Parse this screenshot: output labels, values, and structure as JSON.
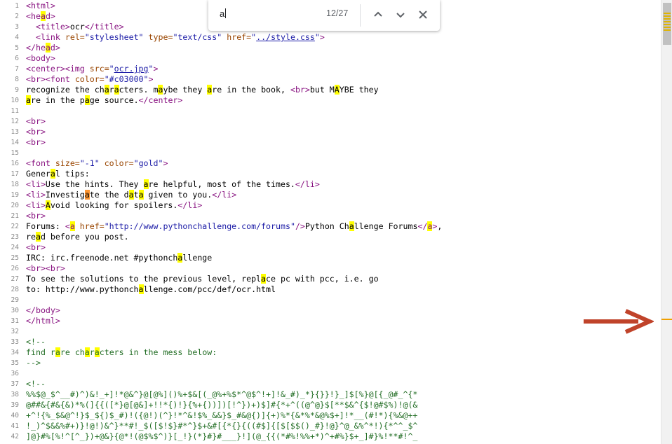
{
  "find_bar": {
    "query": "a",
    "count": "12/27"
  },
  "colors": {
    "highlight": "#ffff00",
    "current_highlight": "#ff9632",
    "tag": "#881280",
    "attribute": "#994500",
    "value": "#1a1aa6",
    "comment": "#236e25",
    "arrow": "#c0432a"
  },
  "icons": [
    "chevron-up-icon",
    "chevron-down-icon",
    "close-icon",
    "arrow-right-icon"
  ],
  "lines": [
    {
      "n": "1",
      "html": "<span class=\"tag\">&lt;html&gt;</span>"
    },
    {
      "n": "2",
      "html": "<span class=\"tag\">&lt;he<mark>a</mark>d&gt;</span>"
    },
    {
      "n": "3",
      "html": "  <span class=\"tag\">&lt;title&gt;</span>ocr<span class=\"tag\">&lt;/title&gt;</span>"
    },
    {
      "n": "4",
      "html": "  <span class=\"tag\">&lt;link </span><span class=\"attr\">rel=</span><span class=\"val\">\"stylesheet\"</span> <span class=\"attr\">type=</span><span class=\"val\">\"text/css\"</span> <span class=\"attr\">href=</span><span class=\"val\">\"</span><span class=\"lnk\">../style.css</span><span class=\"val\">\"</span><span class=\"tag\">&gt;</span>"
    },
    {
      "n": "5",
      "html": "<span class=\"tag\">&lt;/he<mark>a</mark>d&gt;</span>"
    },
    {
      "n": "6",
      "html": "<span class=\"tag\">&lt;body&gt;</span>"
    },
    {
      "n": "7",
      "html": "<span class=\"tag\">&lt;center&gt;&lt;img </span><span class=\"attr\">src=</span><span class=\"val\">\"</span><span class=\"lnk\">ocr.jpg</span><span class=\"val\">\"</span><span class=\"tag\">&gt;</span>"
    },
    {
      "n": "8",
      "html": "<span class=\"tag\">&lt;br&gt;&lt;font </span><span class=\"attr\">color=</span><span class=\"val\">\"#c03000\"</span><span class=\"tag\">&gt;</span>"
    },
    {
      "n": "9",
      "html": "recognize the ch<mark>a</mark>r<mark>a</mark>cters. m<mark>a</mark>ybe they <mark>a</mark>re in the book, <span class=\"tag\">&lt;br&gt;</span>but M<mark>A</mark>YBE they"
    },
    {
      "n": "10",
      "html": "<mark>a</mark>re in the p<mark>a</mark>ge source.<span class=\"tag\">&lt;/center&gt;</span>"
    },
    {
      "n": "11",
      "html": ""
    },
    {
      "n": "12",
      "html": "<span class=\"tag\">&lt;br&gt;</span>"
    },
    {
      "n": "13",
      "html": "<span class=\"tag\">&lt;br&gt;</span>"
    },
    {
      "n": "14",
      "html": "<span class=\"tag\">&lt;br&gt;</span>"
    },
    {
      "n": "15",
      "html": ""
    },
    {
      "n": "16",
      "html": "<span class=\"tag\">&lt;font </span><span class=\"attr\">size=</span><span class=\"val\">\"-1\"</span> <span class=\"attr\">color=</span><span class=\"val\">\"gold\"</span><span class=\"tag\">&gt;</span>"
    },
    {
      "n": "17",
      "html": "Gener<mark>a</mark>l tips:"
    },
    {
      "n": "18",
      "html": "<span class=\"tag\">&lt;li&gt;</span>Use the hints. They <mark>a</mark>re helpful, most of the times.<span class=\"tag\">&lt;/li&gt;</span>"
    },
    {
      "n": "19",
      "html": "<span class=\"tag\">&lt;li&gt;</span>Investig<mark class=\"cur\">a</mark>te the d<mark>a</mark>t<mark>a</mark> given to you.<span class=\"tag\">&lt;/li&gt;</span>"
    },
    {
      "n": "20",
      "html": "<span class=\"tag\">&lt;li&gt;</span><mark>A</mark>void looking for spoilers.<span class=\"tag\">&lt;/li&gt;</span>"
    },
    {
      "n": "21",
      "html": "<span class=\"tag\">&lt;br&gt;</span>"
    },
    {
      "n": "22",
      "html": "Forums: <span class=\"tag\">&lt;<mark>a</mark> </span><span class=\"attr\">href=</span><span class=\"val\">\"http://www.pythonchallenge.com/forums\"</span><span class=\"tag\">/&gt;</span>Python Ch<mark>a</mark>llenge Forums<span class=\"tag\">&lt;/<mark>a</mark>&gt;</span>,"
    },
    {
      "n": "23",
      "html": "re<mark>a</mark>d before you post."
    },
    {
      "n": "24",
      "html": "<span class=\"tag\">&lt;br&gt;</span>"
    },
    {
      "n": "25",
      "html": "IRC: irc.freenode.net #pythonch<mark>a</mark>llenge"
    },
    {
      "n": "26",
      "html": "<span class=\"tag\">&lt;br&gt;&lt;br&gt;</span>"
    },
    {
      "n": "27",
      "html": "To see the solutions to the previous level, repl<mark>a</mark>ce pc with pcc, i.e. go"
    },
    {
      "n": "28",
      "html": "to: http://www.pythonch<mark>a</mark>llenge.com/pcc/def/ocr.html"
    },
    {
      "n": "29",
      "html": ""
    },
    {
      "n": "30",
      "html": "<span class=\"tag\">&lt;/body&gt;</span>"
    },
    {
      "n": "31",
      "html": "<span class=\"tag\">&lt;/html&gt;</span>"
    },
    {
      "n": "32",
      "html": ""
    },
    {
      "n": "33",
      "html": "<span class=\"com\">&lt;!--</span>"
    },
    {
      "n": "34",
      "html": "<span class=\"com\">find r<mark>a</mark>re ch<mark>a</mark>r<mark>a</mark>cters in the mess below:</span>"
    },
    {
      "n": "35",
      "html": "<span class=\"com\">--&gt;</span>"
    },
    {
      "n": "36",
      "html": ""
    },
    {
      "n": "37",
      "html": "<span class=\"com\">&lt;!--</span>"
    },
    {
      "n": "38",
      "html": "<span class=\"com\">%%$@_$^__#)^)&amp;!_+]!*@&amp;^}@[@%]()%+$&amp;[(_@%+%$*^@$^!+]!&amp;_#)_*}{}}!}_]$[%}@[{_@#_^{*</span>"
    },
    {
      "n": "39",
      "html": "<span class=\"com\">@##&amp;{#&amp;{&amp;)*%(]{{([*}@[@&amp;]+!!*{)!}{%+{))])[!^})+)$]#{*+^((@^@}$[**$&amp;^{$!@#$%)!@(&amp;</span>"
    },
    {
      "n": "40",
      "html": "<span class=\"com\">+^!{%_$&amp;@^!}$_${)$_#)!({@!)(^}!*^&amp;!$%_&amp;&amp;}$_#&amp;@{)]{+)%*{&amp;*%*&amp;@%$+]!*__(#!*){%&amp;@++</span>"
    },
    {
      "n": "41",
      "html": "<span class=\"com\">!_)^$&amp;&amp;%#+)}!@!)&amp;^}**#!_$([$!$}#*^}$+&amp;#[{*{}{((#$]{[$[$$()_#}!@}^@_&amp;%^*!){*^^_$^</span>"
    },
    {
      "n": "42",
      "html": "<span class=\"com\">]@}#%[%!^[^_})+@&amp;}{@*!(@$%$^)}[_!}(*}#}#___}!](@_{{(*#%!%%+*)^+#%}$+_]#}%!**#!^_</span>"
    }
  ]
}
